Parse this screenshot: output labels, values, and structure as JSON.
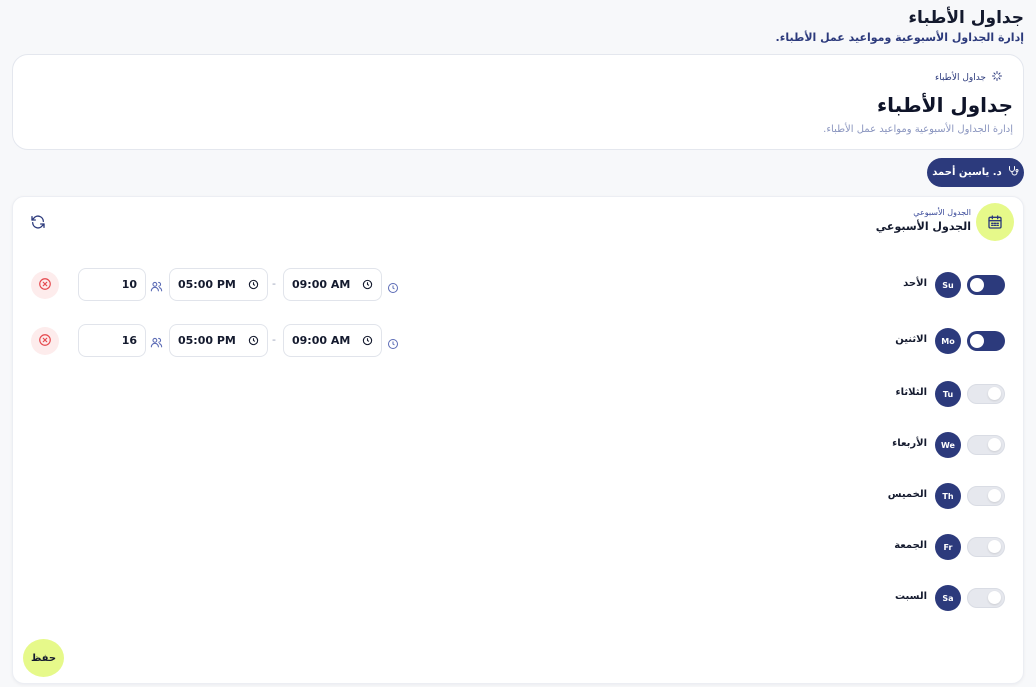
{
  "header": {
    "title": "جداول الأطباء",
    "subtitle": "إدارة الجداول الأسبوعية ومواعيد عمل الأطباء."
  },
  "hero": {
    "crumb": "جداول الأطباء",
    "title": "جداول الأطباء",
    "description": "إدارة الجداول الأسبوعية ومواعيد عمل الأطباء."
  },
  "doctor": {
    "name": "د. ياسين أحمد"
  },
  "schedule": {
    "label": "الجدول الأسبوعي",
    "title": "الجدول الأسبوعي",
    "days": [
      {
        "abbr": "Su",
        "name": "الأحد",
        "enabled": true,
        "start": "09:00 AM",
        "end": "05:00 PM",
        "capacity": "10"
      },
      {
        "abbr": "Mo",
        "name": "الاثنين",
        "enabled": true,
        "start": "09:00 AM",
        "end": "05:00 PM",
        "capacity": "16"
      },
      {
        "abbr": "Tu",
        "name": "الثلاثاء",
        "enabled": false
      },
      {
        "abbr": "We",
        "name": "الأربعاء",
        "enabled": false
      },
      {
        "abbr": "Th",
        "name": "الخميس",
        "enabled": false
      },
      {
        "abbr": "Fr",
        "name": "الجمعة",
        "enabled": false
      },
      {
        "abbr": "Sa",
        "name": "السبت",
        "enabled": false
      }
    ],
    "range_separator": "-"
  },
  "actions": {
    "save_label": "حفظ"
  },
  "colors": {
    "primary": "#2c3a7c",
    "accent": "#e6f98a",
    "danger": "#e5484d"
  }
}
